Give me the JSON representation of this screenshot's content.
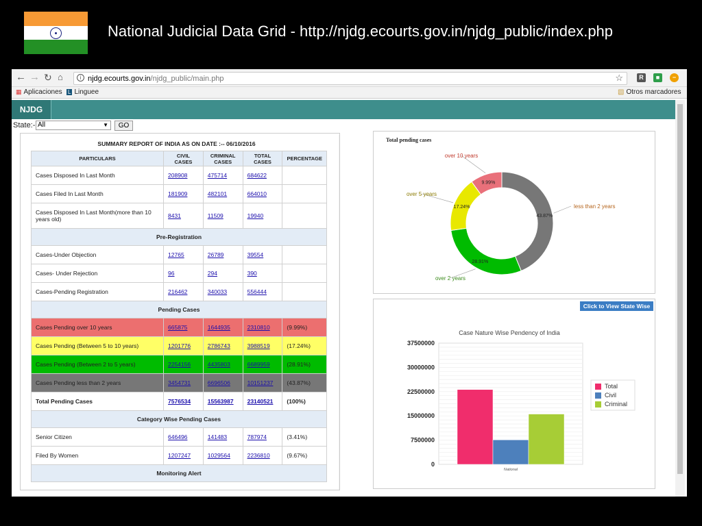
{
  "slide": {
    "title": "National Judicial Data Grid  - http://njdg.ecourts.gov.in/njdg_public/index.php"
  },
  "browser": {
    "url_host": "njdg.ecourts.gov.in",
    "url_path": "/njdg_public/main.php",
    "bookmarks": [
      "Aplicaciones",
      "Linguee",
      "Otros marcadores"
    ]
  },
  "site": {
    "logo": "NJDG",
    "state_label": "State:-",
    "state_value": "All",
    "go_label": "GO"
  },
  "report": {
    "title": "SUMMARY REPORT OF INDIA AS ON DATE :-- 06/10/2016",
    "headers": [
      "PARTICULARS",
      "CIVIL CASES",
      "CRIMINAL CASES",
      "TOTAL CASES",
      "PERCENTAGE"
    ],
    "rows": [
      {
        "label": "Cases Disposed In Last Month",
        "civil": "208908",
        "criminal": "475714",
        "total": "684622",
        "pct": ""
      },
      {
        "label": "Cases Filed In Last Month",
        "civil": "181909",
        "criminal": "482101",
        "total": "664010",
        "pct": ""
      },
      {
        "label": "Cases Disposed In Last Month(more than 10 years old)",
        "civil": "8431",
        "criminal": "11509",
        "total": "19940",
        "pct": ""
      },
      {
        "section": "Pre-Registration"
      },
      {
        "label": "Cases-Under Objection",
        "civil": "12765",
        "criminal": "26789",
        "total": "39554",
        "pct": ""
      },
      {
        "label": "Cases- Under Rejection",
        "civil": "96",
        "criminal": "294",
        "total": "390",
        "pct": ""
      },
      {
        "label": "Cases-Pending Registration",
        "civil": "216462",
        "criminal": "340033",
        "total": "556444",
        "pct": ""
      },
      {
        "section": "Pending Cases"
      },
      {
        "label": "Cases Pending over 10 years",
        "civil": "665875",
        "criminal": "1644935",
        "total": "2310810",
        "pct": "(9.99%)",
        "style": "r-red"
      },
      {
        "label": "Cases Pending (Between 5 to 10 years)",
        "civil": "1201776",
        "criminal": "2786743",
        "total": "3988519",
        "pct": "(17.24%)",
        "style": "r-yellow"
      },
      {
        "label": "Cases Pending (Between 2 to 5 years)",
        "civil": "2254156",
        "criminal": "4435803",
        "total": "6689959",
        "pct": "(28.91%)",
        "style": "r-green"
      },
      {
        "label": "Cases Pending less than 2 years",
        "civil": "3454731",
        "criminal": "6696506",
        "total": "10151237",
        "pct": "(43.87%)",
        "style": "r-gray"
      },
      {
        "label": "Total Pending Cases",
        "civil": "7576534",
        "criminal": "15563987",
        "total": "23140521",
        "pct": "(100%)",
        "style": "total"
      },
      {
        "section": "Category Wise Pending Cases"
      },
      {
        "label": "Senior Citizen",
        "civil": "646496",
        "criminal": "141483",
        "total": "787974",
        "pct": "(3.41%)"
      },
      {
        "label": "Filed By Women",
        "civil": "1207247",
        "criminal": "1029564",
        "total": "2236810",
        "pct": "(9.67%)"
      },
      {
        "section": "Monitoring Alert"
      }
    ]
  },
  "donut": {
    "title": "Total pending cases"
  },
  "bar_panel": {
    "button": "Click to View State Wise"
  },
  "chart_data": [
    {
      "type": "pie",
      "title": "Total pending cases",
      "categories": [
        "less than 2 years",
        "over 2 years",
        "over 5 years",
        "over 10 years"
      ],
      "values": [
        43.87,
        28.91,
        17.24,
        9.99
      ],
      "labels": [
        "43.87%",
        "28.91%",
        "17.24%",
        "9.99%"
      ],
      "colors": [
        "#777777",
        "#00bb00",
        "#e8e800",
        "#e9707a"
      ]
    },
    {
      "type": "bar",
      "title": "Case Nature Wise Pendency of India",
      "categories": [
        "National"
      ],
      "series": [
        {
          "name": "Total",
          "values": [
            23140521
          ],
          "color": "#f02d6c"
        },
        {
          "name": "Civil",
          "values": [
            7576534
          ],
          "color": "#4d80bc"
        },
        {
          "name": "Criminal",
          "values": [
            15563987
          ],
          "color": "#a7cd36"
        }
      ],
      "ylim": [
        0,
        37500000
      ],
      "yticks": [
        "37500000",
        "30000000",
        "22500000",
        "15000000",
        "7500000",
        "0"
      ]
    }
  ]
}
